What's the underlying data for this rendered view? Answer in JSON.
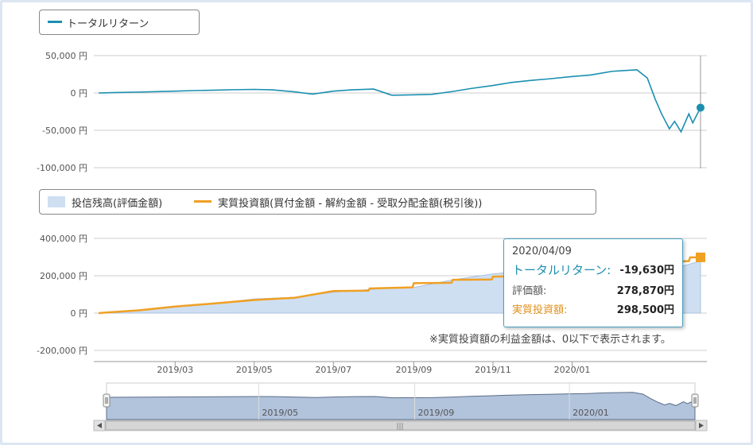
{
  "chart_data": [
    {
      "type": "line",
      "series": [
        {
          "name": "トータルリターン",
          "x": [
            "2019-01-01",
            "2019-01-15",
            "2019-02-01",
            "2019-02-15",
            "2019-03-01",
            "2019-03-15",
            "2019-04-01",
            "2019-04-15",
            "2019-05-01",
            "2019-05-15",
            "2019-06-01",
            "2019-06-15",
            "2019-07-01",
            "2019-07-15",
            "2019-08-01",
            "2019-08-15",
            "2019-09-01",
            "2019-09-15",
            "2019-10-01",
            "2019-10-15",
            "2019-11-01",
            "2019-11-15",
            "2019-12-01",
            "2019-12-15",
            "2020-01-01",
            "2020-01-15",
            "2020-02-01",
            "2020-02-10",
            "2020-02-20",
            "2020-02-28",
            "2020-03-05",
            "2020-03-10",
            "2020-03-16",
            "2020-03-20",
            "2020-03-25",
            "2020-03-31",
            "2020-04-03",
            "2020-04-09"
          ],
          "values": [
            0,
            600,
            1200,
            1800,
            2500,
            3200,
            3800,
            4400,
            4800,
            4200,
            1500,
            -1500,
            2500,
            4200,
            5200,
            -3000,
            -2500,
            -1800,
            2000,
            6000,
            10000,
            14000,
            17000,
            19000,
            22000,
            24000,
            29000,
            30000,
            31000,
            20000,
            -8000,
            -28000,
            -48000,
            -38000,
            -52000,
            -28000,
            -40000,
            -19630
          ]
        }
      ],
      "yticks": [
        "50,000 円",
        "0 円",
        "-50,000 円",
        "-100,000 円"
      ],
      "ylim": [
        -100000,
        50000
      ]
    },
    {
      "type": "area",
      "series": [
        {
          "name": "投信残高(評価金額)",
          "x": [
            "2019-01-01",
            "2019-02-01",
            "2019-03-01",
            "2019-04-01",
            "2019-05-01",
            "2019-06-01",
            "2019-07-01",
            "2019-08-01",
            "2019-08-15",
            "2019-09-01",
            "2019-10-01",
            "2019-11-01",
            "2019-12-01",
            "2020-01-01",
            "2020-02-01",
            "2020-02-20",
            "2020-03-05",
            "2020-03-16",
            "2020-03-25",
            "2020-04-09"
          ],
          "values": [
            0,
            12000,
            32000,
            52000,
            76000,
            85000,
            112000,
            128000,
            135000,
            137000,
            178000,
            210000,
            230000,
            255000,
            285000,
            300000,
            285000,
            245000,
            250000,
            278870
          ]
        },
        {
          "name": "実質投資額(買付金額 - 解約金額 - 受取分配金額(税引後))",
          "x": [
            "2019-01-01",
            "2019-02-01",
            "2019-03-01",
            "2019-04-01",
            "2019-05-01",
            "2019-06-01",
            "2019-07-01",
            "2019-07-28",
            "2019-07-29",
            "2019-08-31",
            "2019-09-01",
            "2019-09-30",
            "2019-10-01",
            "2019-10-31",
            "2019-11-01",
            "2019-11-30",
            "2019-12-01",
            "2019-12-31",
            "2020-01-01",
            "2020-01-31",
            "2020-02-01",
            "2020-02-29",
            "2020-03-01",
            "2020-03-31",
            "2020-04-01",
            "2020-04-09"
          ],
          "values": [
            0,
            15000,
            35000,
            52000,
            70000,
            82000,
            118000,
            120000,
            132000,
            138000,
            160000,
            162000,
            178000,
            180000,
            195000,
            198000,
            220000,
            222000,
            240000,
            245000,
            260000,
            265000,
            275000,
            278000,
            298500,
            298500
          ]
        }
      ],
      "yticks": [
        "400,000 円",
        "200,000 円",
        "0 円",
        "-200,000 円"
      ],
      "ylim": [
        -200000,
        400000
      ],
      "xticks": [
        "2019/03",
        "2019/05",
        "2019/07",
        "2019/09",
        "2019/11",
        "2020/01"
      ]
    }
  ],
  "legend1": {
    "label": "トータルリターン"
  },
  "legend2": {
    "area_label": "投信残高(評価金額)",
    "line_label": "実質投資額(買付金額 - 解約金額 - 受取分配金額(税引後))"
  },
  "tooltip": {
    "date": "2020/04/09",
    "total_return_label": "トータルリターン:",
    "total_return_value": "-19,630円",
    "valuation_label": "評価額:",
    "valuation_value": "278,870円",
    "investment_label": "実質投資額:",
    "investment_value": "298,500円"
  },
  "note": "※実質投資額の利益金額は、0以下で表示されます。",
  "navigator": {
    "xticks": [
      "2019/05",
      "2019/09",
      "2020/01"
    ],
    "scroll_grip": "|||"
  },
  "colors": {
    "return_line": "#1b8fb0",
    "investment_line": "#f0a023",
    "area_fill": "#cfdff2",
    "navigator_fill": "#b2c3dc",
    "navigator_line": "#5a6c87"
  }
}
